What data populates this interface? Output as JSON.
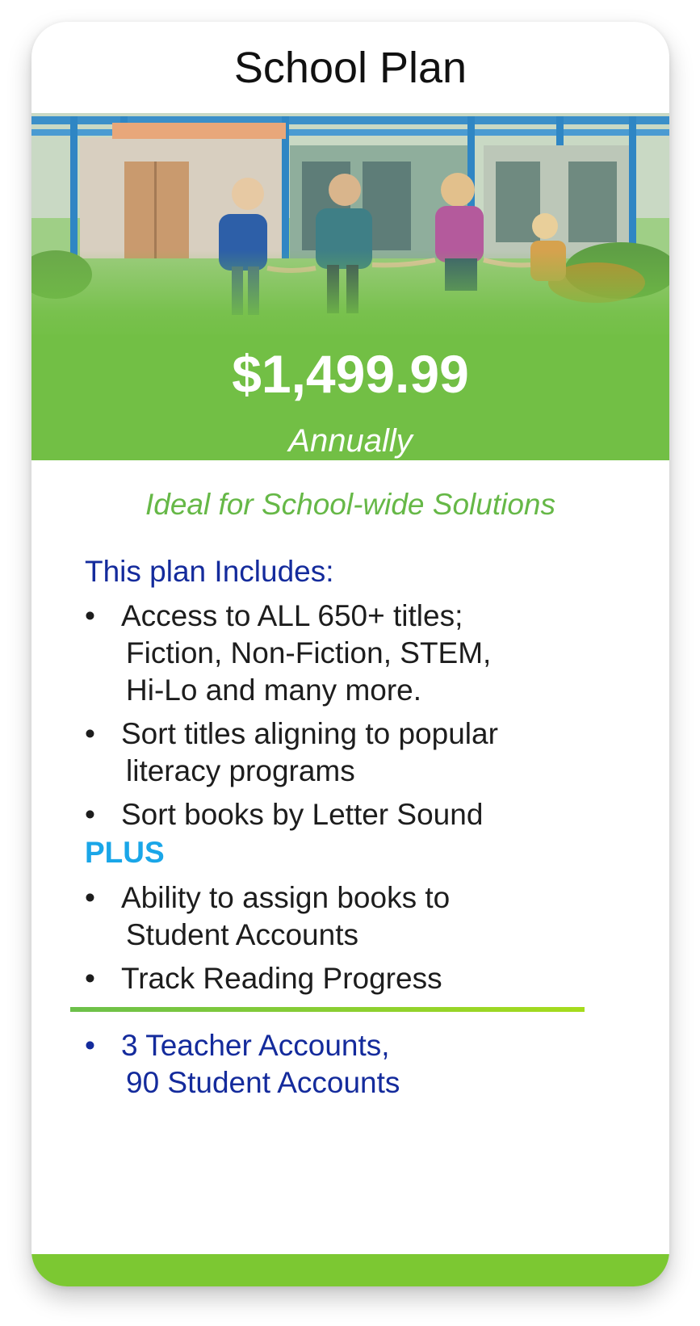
{
  "card": {
    "title": "School Plan",
    "price": "$1,499.99",
    "period": "Annually",
    "tagline": "Ideal for School-wide Solutions",
    "includes_heading": "This plan Includes:",
    "bullet_glyph": "•",
    "features": [
      {
        "lines": [
          "Access to ALL 650+ titles;",
          "Fiction, Non-Fiction, STEM,",
          "Hi-Lo and many more."
        ]
      },
      {
        "lines": [
          "Sort titles aligning to popular",
          "literacy programs"
        ]
      },
      {
        "lines": [
          "Sort books by Letter Sound"
        ]
      }
    ],
    "plus_label": "PLUS",
    "plus_features": [
      {
        "lines": [
          "Ability to assign books to",
          "Student Accounts"
        ]
      },
      {
        "lines": [
          "Track Reading Progress"
        ]
      }
    ],
    "accounts": {
      "lines": [
        "3 Teacher Accounts,",
        "90 Student Accounts"
      ]
    }
  },
  "colors": {
    "accent_green": "#72bf45",
    "tagline_green": "#66b847",
    "heading_blue": "#142b9c",
    "plus_blue": "#1aa6e8",
    "footer_green": "#7cc832"
  },
  "image": {
    "icon": "school-children-photo"
  }
}
